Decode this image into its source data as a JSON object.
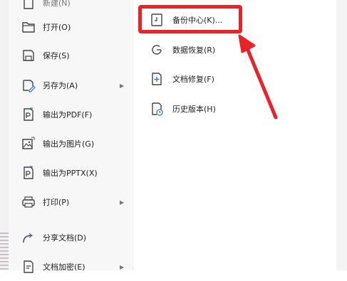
{
  "file_menu": {
    "top_partial": "新建(N)",
    "items": [
      {
        "label": "打开(O)",
        "icon": "folder-open-icon",
        "has_submenu": false
      },
      {
        "label": "保存(S)",
        "icon": "save-icon",
        "has_submenu": false
      },
      {
        "label": "另存为(A)",
        "icon": "save-as-icon",
        "has_submenu": true
      },
      {
        "label": "输出为PDF(F)",
        "icon": "export-pdf-icon",
        "has_submenu": false
      },
      {
        "label": "输出为图片(G)",
        "icon": "export-image-icon",
        "has_submenu": false
      },
      {
        "label": "输出为PPTX(X)",
        "icon": "export-pptx-icon",
        "has_submenu": false
      },
      {
        "label": "打印(P)",
        "icon": "printer-icon",
        "has_submenu": true
      },
      {
        "label": "分享文档(D)",
        "icon": "share-icon",
        "has_submenu": false
      },
      {
        "label": "文档加密(E)",
        "icon": "encrypt-icon",
        "has_submenu": true
      }
    ]
  },
  "submenu": {
    "items": [
      {
        "label": "备份中心(K)...",
        "icon": "backup-center-icon"
      },
      {
        "label": "数据恢复(R)",
        "icon": "data-recovery-icon"
      },
      {
        "label": "文档修复(F)",
        "icon": "document-repair-icon"
      },
      {
        "label": "历史版本(H)",
        "icon": "history-version-icon"
      }
    ]
  },
  "colors": {
    "annotation": "#e8232a",
    "menu_bg": "#f7f7f7"
  }
}
